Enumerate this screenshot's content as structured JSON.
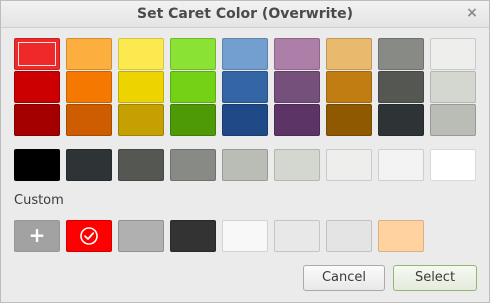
{
  "window": {
    "title": "Set Caret Color (Overwrite)",
    "close_glyph": "×",
    "close_icon": "close-icon"
  },
  "palette": {
    "columns": [
      {
        "name": "red",
        "shades": [
          "#ef2929",
          "#cc0000",
          "#a40000"
        ]
      },
      {
        "name": "orange",
        "shades": [
          "#fcaf3e",
          "#f57900",
          "#ce5c00"
        ]
      },
      {
        "name": "yellow",
        "shades": [
          "#fce94f",
          "#edd400",
          "#c4a000"
        ]
      },
      {
        "name": "green",
        "shades": [
          "#8ae234",
          "#73d216",
          "#4e9a06"
        ]
      },
      {
        "name": "blue",
        "shades": [
          "#729fcf",
          "#3465a4",
          "#204a87"
        ]
      },
      {
        "name": "purple",
        "shades": [
          "#ad7fa8",
          "#75507b",
          "#5c3566"
        ]
      },
      {
        "name": "brown",
        "shades": [
          "#e9b96e",
          "#c17d11",
          "#8f5902"
        ]
      },
      {
        "name": "dark-gray",
        "shades": [
          "#888a85",
          "#555753",
          "#2e3436"
        ]
      },
      {
        "name": "light-gray",
        "shades": [
          "#eeeeec",
          "#d3d7cf",
          "#babdb6"
        ]
      }
    ],
    "selected": {
      "column": 0,
      "row": 0
    },
    "grays": [
      "#000000",
      "#2e3436",
      "#555753",
      "#888a85",
      "#babdb6",
      "#d3d7cf",
      "#eeeeec",
      "#f3f3f3",
      "#ffffff"
    ]
  },
  "custom": {
    "label": "Custom",
    "add_label": "+",
    "colors": [
      "#ff0000",
      "#b0b0b0",
      "#333333",
      "#f8f8f8",
      "#e8e8e8",
      "#e4e4e4",
      "#ffd2a0"
    ],
    "current_index": 0,
    "check_icon": "check-circle-icon"
  },
  "buttons": {
    "cancel": "Cancel",
    "select": "Select"
  }
}
